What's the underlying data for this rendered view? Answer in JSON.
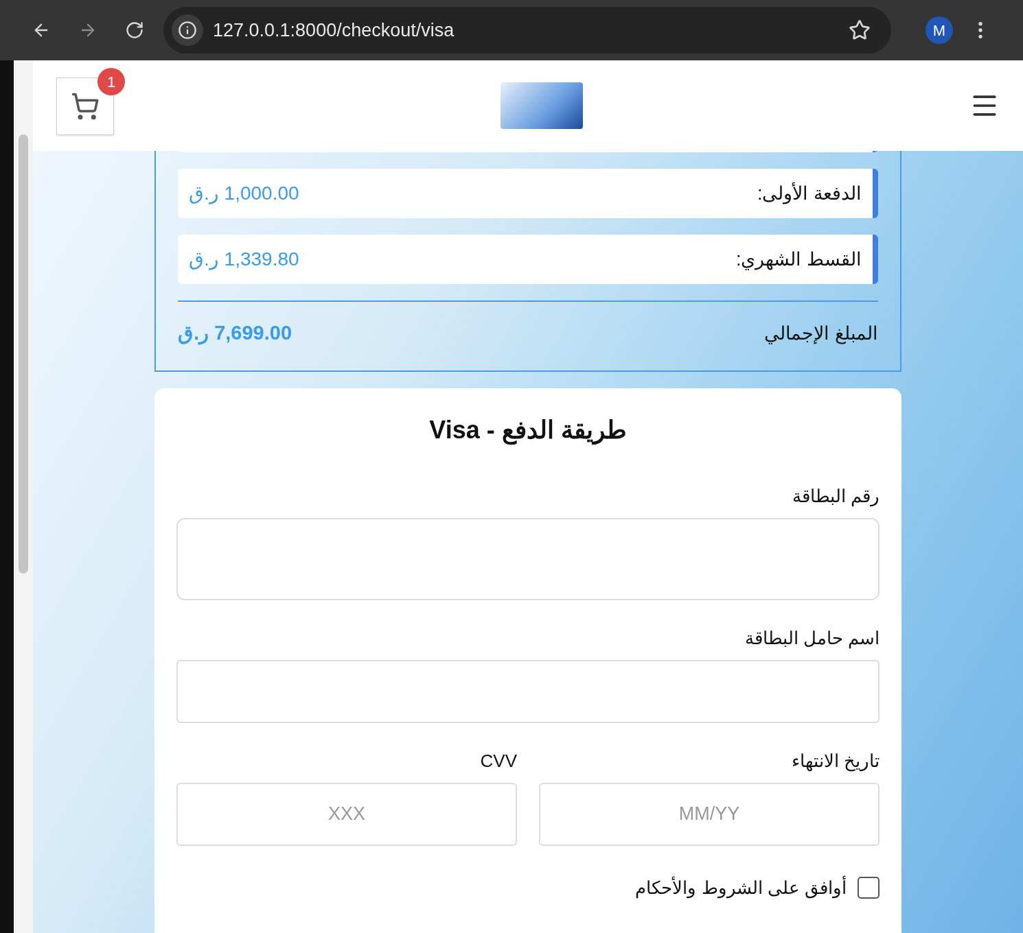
{
  "browser": {
    "url": "127.0.0.1:8000/checkout/visa",
    "profile_initial": "M"
  },
  "header": {
    "cart_count": "1"
  },
  "summary": {
    "rows": [
      {
        "label": "الدفعة الأولى:",
        "value": "1,000.00 ر.ق"
      },
      {
        "label": "القسط الشهري:",
        "value": "1,339.80 ر.ق"
      }
    ],
    "total_label": "المبلغ الإجمالي",
    "total_value": "7,699.00 ر.ق"
  },
  "form": {
    "title": "طريقة الدفع - Visa",
    "card_number": {
      "label": "رقم البطاقة"
    },
    "holder": {
      "label": "اسم حامل البطاقة"
    },
    "expiry": {
      "label": "تاريخ الانتهاء",
      "placeholder": "MM/YY"
    },
    "cvv": {
      "label": "CVV",
      "placeholder": "XXX"
    },
    "terms": {
      "label": "أوافق على الشروط والأحكام",
      "checked": false
    }
  }
}
